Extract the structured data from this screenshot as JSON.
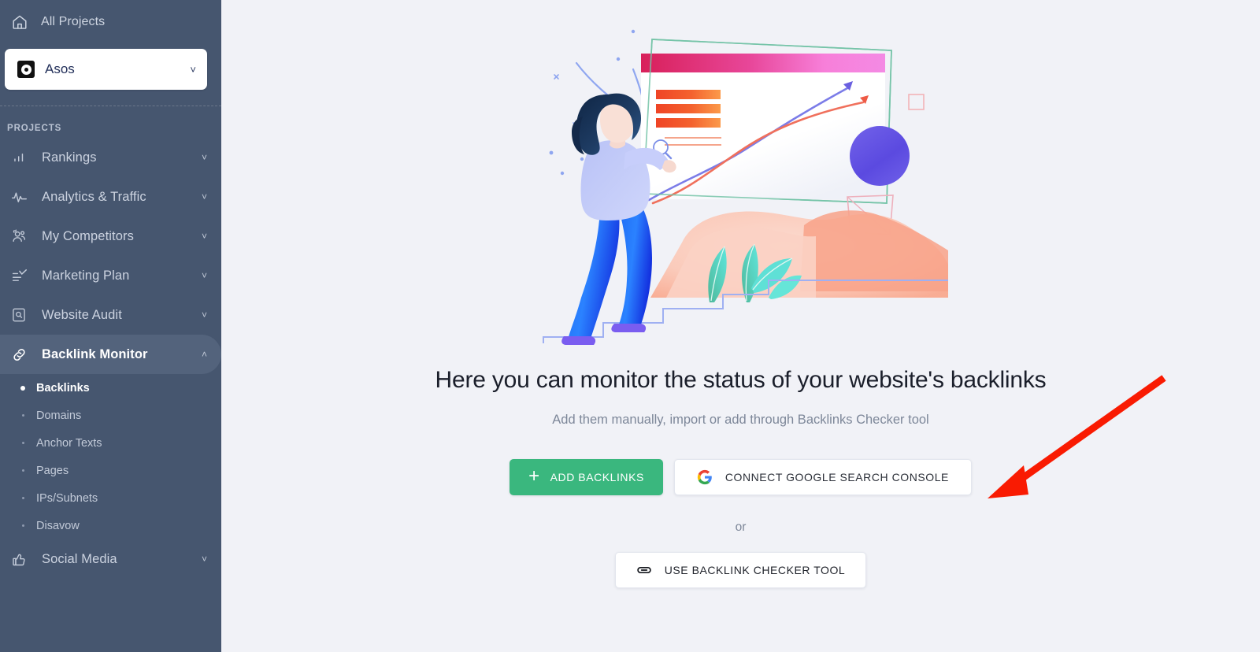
{
  "sidebar": {
    "all_projects": {
      "label": "All Projects",
      "icon": "home-icon"
    },
    "project_selector": {
      "name": "Asos",
      "chevron": "˅",
      "favicon": "asos-favicon"
    },
    "section_label": "PROJECTS",
    "items": [
      {
        "label": "Rankings",
        "icon": "bar-chart-icon",
        "arrow": "˅",
        "active": false
      },
      {
        "label": "Analytics & Traffic",
        "icon": "pulse-icon",
        "arrow": "˅",
        "active": false
      },
      {
        "label": "My Competitors",
        "icon": "people-icon",
        "arrow": "˅",
        "active": false
      },
      {
        "label": "Marketing Plan",
        "icon": "checklist-icon",
        "arrow": "˅",
        "active": false
      },
      {
        "label": "Website Audit",
        "icon": "magnifier-doc-icon",
        "arrow": "˅",
        "active": false
      },
      {
        "label": "Backlink Monitor",
        "icon": "link-icon",
        "arrow": "˄",
        "active": true
      }
    ],
    "sub_items": [
      {
        "label": "Backlinks",
        "current": true
      },
      {
        "label": "Domains",
        "current": false
      },
      {
        "label": "Anchor Texts",
        "current": false
      },
      {
        "label": "Pages",
        "current": false
      },
      {
        "label": "IPs/Subnets",
        "current": false
      },
      {
        "label": "Disavow",
        "current": false
      }
    ],
    "social_media": {
      "label": "Social Media",
      "icon": "thumbs-up-icon",
      "arrow": "˅"
    }
  },
  "main": {
    "illustration_name": "woman-analyzing-chart-illustration",
    "heading": "Here you can monitor the status of your website's backlinks",
    "subheading": "Add them manually, import or add through Backlinks Checker tool",
    "add_backlinks_button": {
      "label": "ADD BACKLINKS",
      "plus": "+"
    },
    "connect_gsc_button": {
      "label": "CONNECT GOOGLE SEARCH CONSOLE",
      "icon": "google-g-icon"
    },
    "or_label": "or",
    "checker_button": {
      "label": "USE BACKLINK CHECKER TOOL",
      "icon": "link-icon"
    }
  },
  "annotation": {
    "name": "red-arrow-pointing-to-connect-google-search-console"
  },
  "colors": {
    "sidebar_bg": "#46566f",
    "sidebar_active_bg": "#53637c",
    "page_bg": "#f1f2f7",
    "green_accent": "#3ab77e",
    "heading_text": "#1b1f2b",
    "muted_text": "#7d8799",
    "annotation_red": "#f91b02"
  }
}
